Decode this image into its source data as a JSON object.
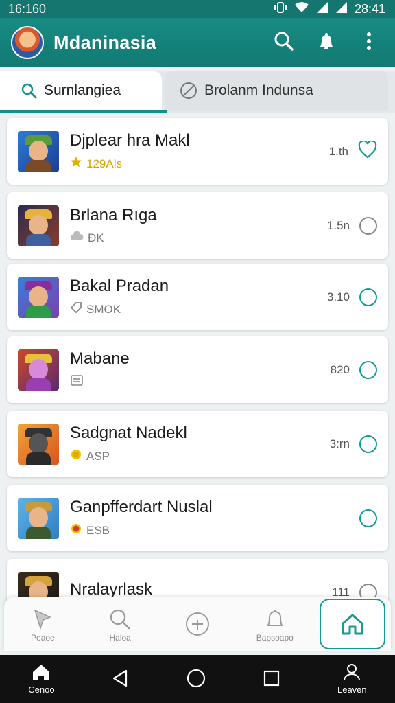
{
  "status_bar": {
    "time": "16:160",
    "clock_right": "28:41"
  },
  "app_bar": {
    "title": "Mdaninasia"
  },
  "tabs": [
    {
      "label": "Surnlangiea",
      "icon": "search-icon"
    },
    {
      "label": "Brolanm Indunsa",
      "icon": "cancel-circle-icon"
    }
  ],
  "items": [
    {
      "title": "Djplear hra Makl",
      "sub": "129Als",
      "sub_icon": "star-icon",
      "meta": "1.th",
      "status": "heart"
    },
    {
      "title": "Brlana Rıga",
      "sub": "ÐK",
      "sub_icon": "cloud-icon",
      "meta": "1.5n",
      "status": "circle"
    },
    {
      "title": "Bakal Pradan",
      "sub": "SMOK",
      "sub_icon": "tag-icon",
      "meta": "3.10",
      "status": "circle-teal"
    },
    {
      "title": "Mabane",
      "sub": "",
      "sub_icon": "list-icon",
      "meta": "820",
      "status": "circle-teal"
    },
    {
      "title": "Sadgnat Nadekl",
      "sub": "ASP",
      "sub_icon": "coin-icon",
      "meta": "3:rn",
      "status": "circle-teal"
    },
    {
      "title": "Ganpfferdart Nuslal",
      "sub": "ESB",
      "sub_icon": "record-icon",
      "meta": "",
      "status": "circle-teal"
    },
    {
      "title": "Nralayrlask",
      "sub": "",
      "sub_icon": "",
      "meta": "111",
      "status": "circle"
    }
  ],
  "bottom_nav": [
    {
      "label": "Peaoe",
      "icon": "pin-icon"
    },
    {
      "label": "Haloa",
      "icon": "search-icon"
    },
    {
      "label": "",
      "icon": "add-circle-icon"
    },
    {
      "label": "Bapsoapo",
      "icon": "bell-icon"
    },
    {
      "label": "",
      "icon": "home-icon",
      "active": true
    }
  ],
  "system_nav": [
    {
      "label": "Cenoo",
      "icon": "home-filled-icon"
    },
    {
      "label": "",
      "icon": "back-icon"
    },
    {
      "label": "",
      "icon": "home-circle-icon"
    },
    {
      "label": "",
      "icon": "recents-icon"
    },
    {
      "label": "Leaven",
      "icon": "profile-icon"
    }
  ],
  "colors": {
    "primary": "#14766f",
    "accent": "#179a90",
    "rating": "#d9a400"
  }
}
